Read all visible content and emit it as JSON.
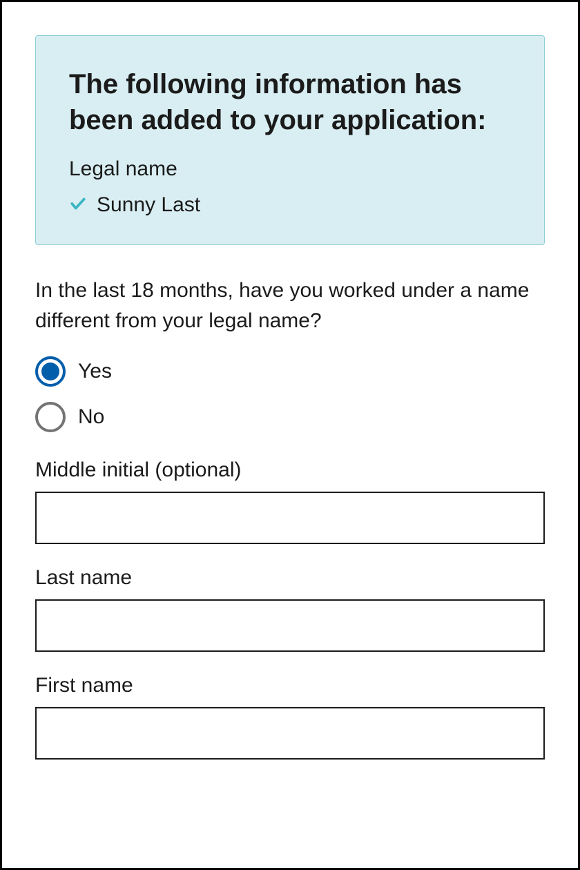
{
  "notice": {
    "title": "The following information has been added to your application:",
    "label": "Legal name",
    "value": "Sunny Last"
  },
  "question": {
    "text": "In the last 18 months, have you worked under a name different from your legal name?",
    "options": {
      "yes": "Yes",
      "no": "No"
    },
    "selected": "yes"
  },
  "fields": {
    "middle_initial": {
      "label": "Middle initial (optional)",
      "value": ""
    },
    "last_name": {
      "label": "Last name",
      "value": ""
    },
    "first_name": {
      "label": "First name",
      "value": ""
    }
  },
  "colors": {
    "notice_bg": "#d9eef2",
    "notice_border": "#8ecfd6",
    "radio_selected": "#015eab",
    "radio_unselected": "#747474",
    "check": "#3bb6c4"
  }
}
